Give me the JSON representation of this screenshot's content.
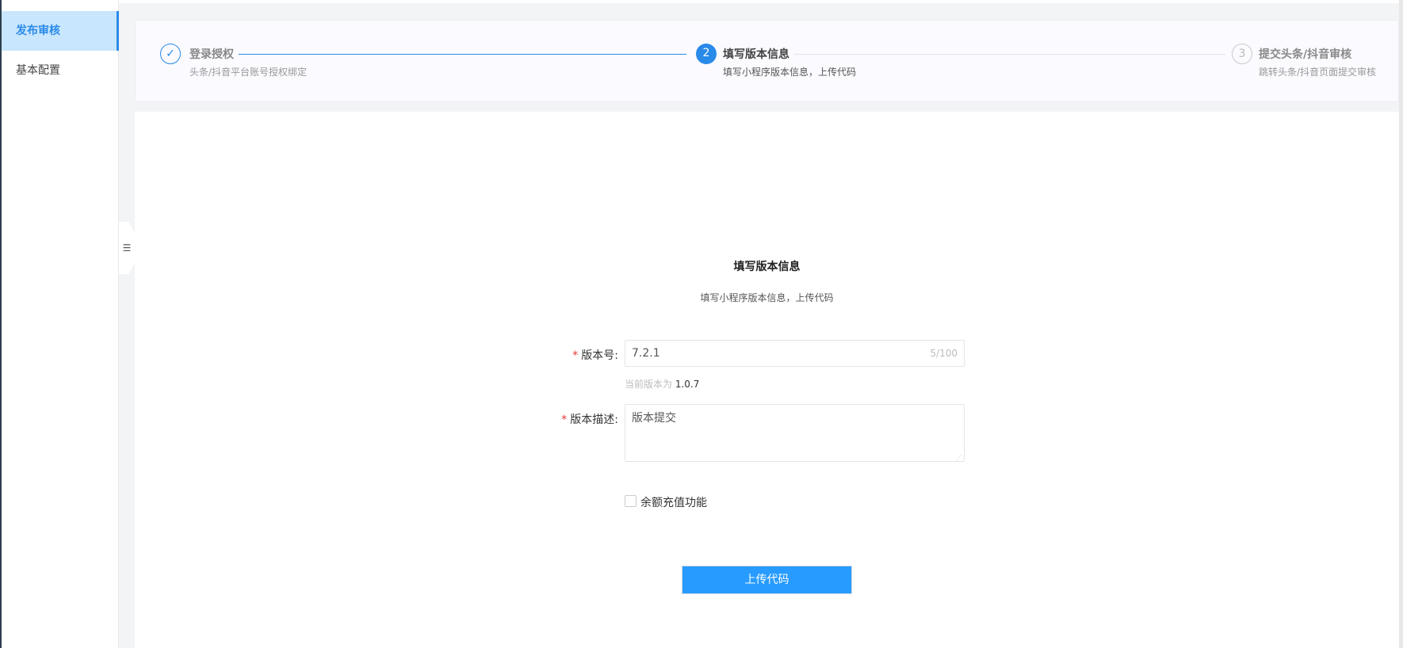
{
  "sidebar": {
    "items": [
      {
        "label": "发布审核",
        "active": true
      },
      {
        "label": "基本配置",
        "active": false
      }
    ]
  },
  "steps": [
    {
      "number": "1",
      "title": "登录授权",
      "desc": "头条/抖音平台账号授权绑定",
      "status": "finished"
    },
    {
      "number": "2",
      "title": "填写版本信息",
      "desc": "填写小程序版本信息，上传代码",
      "status": "active"
    },
    {
      "number": "3",
      "title": "提交头条/抖音审核",
      "desc": "跳转头条/抖音页面提交审核",
      "status": "waiting"
    }
  ],
  "form": {
    "title": "填写版本信息",
    "subtitle": "填写小程序版本信息，上传代码",
    "version_label": "版本号:",
    "version_value": "7.2.1",
    "version_count": "5/100",
    "current_prefix": "当前版本为",
    "current_version": "1.0.7",
    "desc_label": "版本描述:",
    "desc_value": "版本提交",
    "checkbox_label": "余额充值功能",
    "checkbox_checked": false,
    "submit_label": "上传代码"
  },
  "colors": {
    "primary": "#2a8ae8",
    "button": "#279bff",
    "required": "#e53935"
  }
}
